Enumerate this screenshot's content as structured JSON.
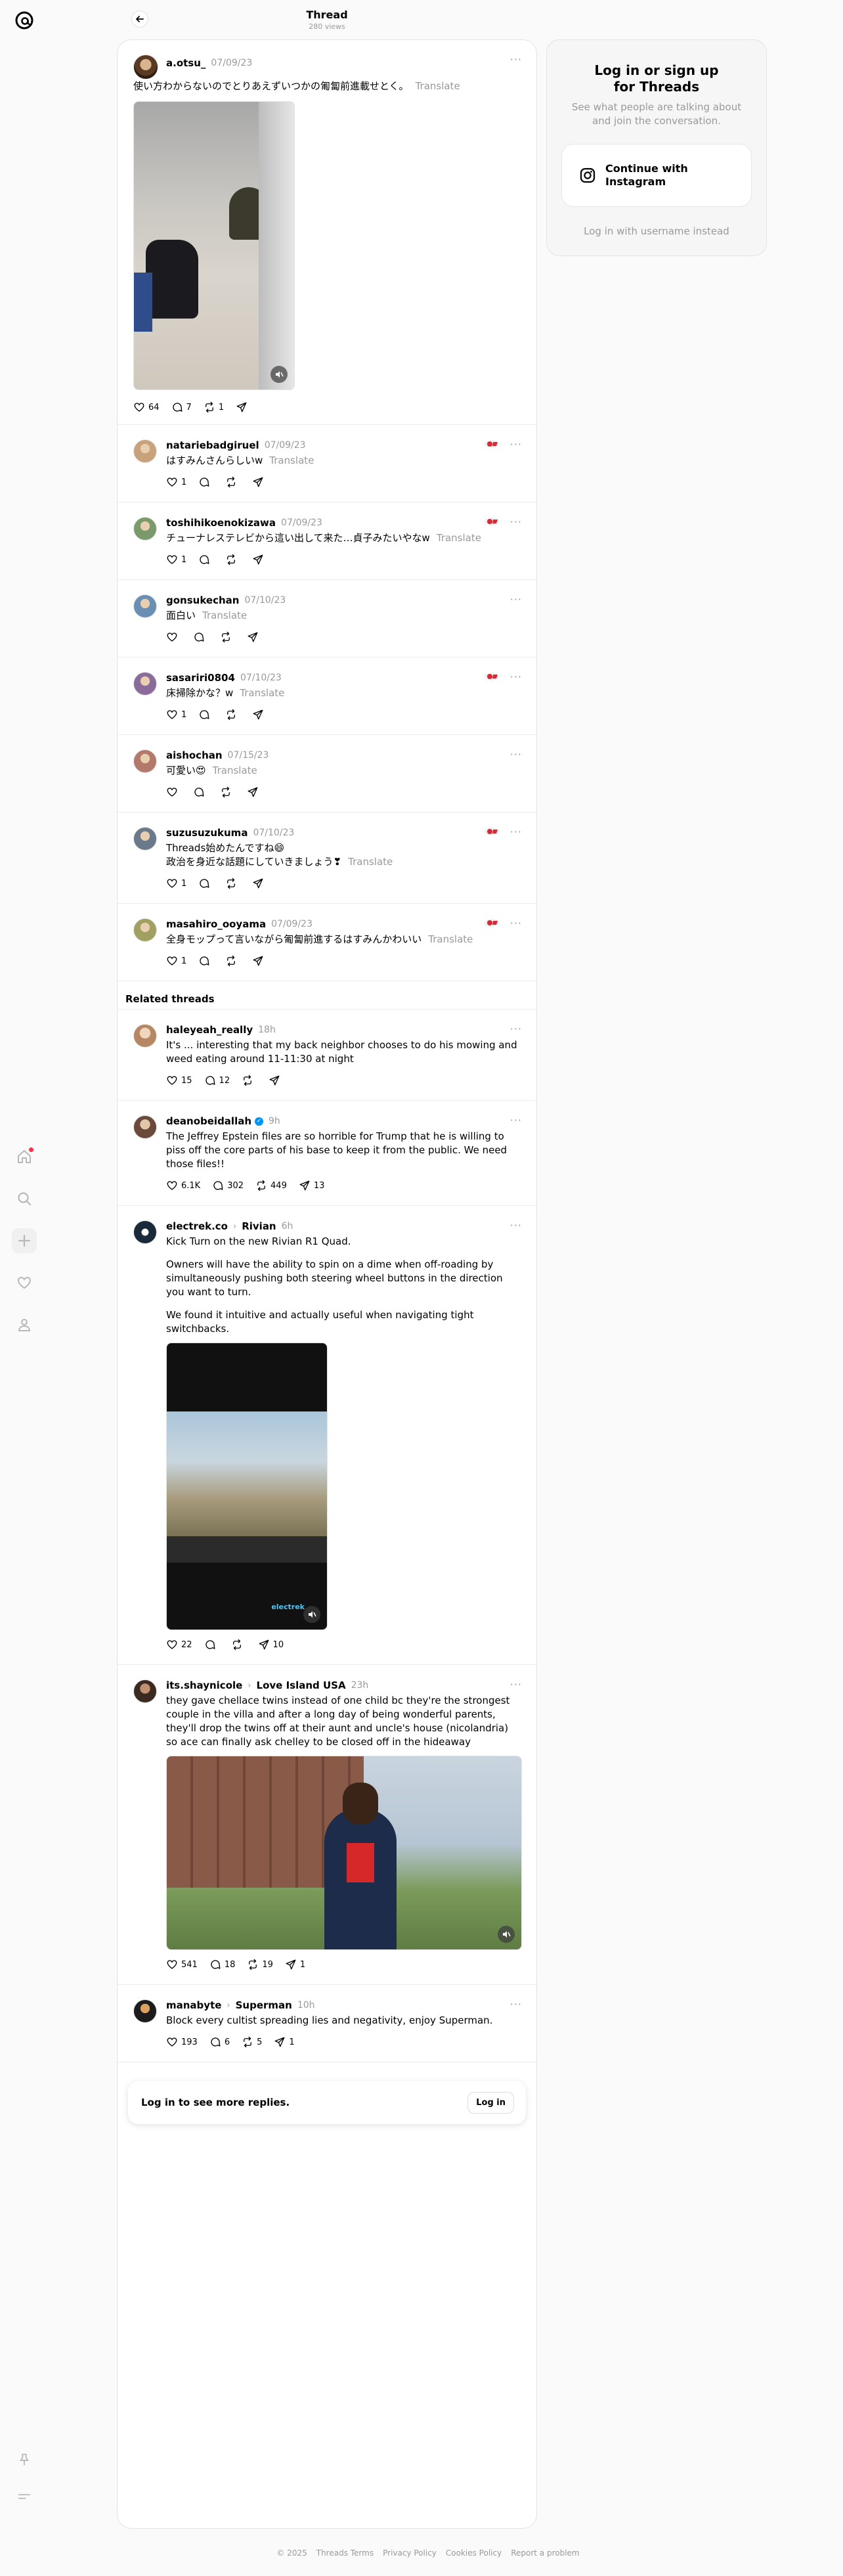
{
  "header": {
    "title": "Thread",
    "subtitle": "280 views"
  },
  "main_post": {
    "user": "a.otsu_",
    "time": "07/09/23",
    "text": "使い方わからないのでとりあえずいつかの匍匐前進載せとく。",
    "translate": "Translate",
    "likes": "64",
    "replies": "7",
    "reposts": "1"
  },
  "replies": [
    {
      "user": "natariebadgiruel",
      "time": "07/09/23",
      "text": "はすみんさんらしいw",
      "likes": "1",
      "badge": true
    },
    {
      "user": "toshihikoenokizawa",
      "time": "07/09/23",
      "text": "チューナレステレビから這い出して来た…貞子みたいやなw",
      "likes": "1",
      "badge": true
    },
    {
      "user": "gonsukechan",
      "time": "07/10/23",
      "text": "面白い",
      "likes": "",
      "badge": false
    },
    {
      "user": "sasariri0804",
      "time": "07/10/23",
      "text": "床掃除かな？w",
      "likes": "1",
      "badge": true
    },
    {
      "user": "aishochan",
      "time": "07/15/23",
      "text": "可愛い😍",
      "likes": "",
      "badge": false
    },
    {
      "user": "suzusuzukuma",
      "time": "07/10/23",
      "text": "Threads始めたんですね😄\n政治を身近な話題にしていきましょう❣",
      "likes": "1",
      "badge": true
    },
    {
      "user": "masahiro_ooyama",
      "time": "07/09/23",
      "text": "全身モップって言いながら匍匐前進するはすみんかわいい",
      "likes": "1",
      "badge": true
    }
  ],
  "related_label": "Related threads",
  "related": [
    {
      "user": "haleyeah_really",
      "time": "18h",
      "community": "",
      "verified": false,
      "paragraphs": [
        "It's ... interesting that my back neighbor chooses to do his mowing and weed eating around 11-11:30 at night"
      ],
      "likes": "15",
      "replies": "12",
      "reposts": "",
      "shares": ""
    },
    {
      "user": "deanobeidallah",
      "time": "9h",
      "community": "",
      "verified": true,
      "paragraphs": [
        "The Jeffrey Epstein files are so horrible for Trump that he is willing to piss off the core parts of his base to keep it from the public. We need those files!!"
      ],
      "likes": "6.1K",
      "replies": "302",
      "reposts": "449",
      "shares": "13"
    },
    {
      "user": "electrek.co",
      "time": "6h",
      "community": "Rivian",
      "verified": false,
      "paragraphs": [
        "Kick Turn on the new Rivian R1 Quad.",
        "Owners will have the ability to spin on a dime when off-roading by simultaneously pushing both steering wheel buttons in the direction you want to turn.",
        "We found it intuitive and actually useful when navigating tight switchbacks."
      ],
      "likes": "22",
      "replies": "",
      "reposts": "",
      "shares": "10"
    },
    {
      "user": "its.shaynicole",
      "time": "23h",
      "community": "Love Island USA",
      "verified": false,
      "paragraphs": [
        "they gave chellace twins instead of one child bc they're the strongest couple in the villa and after a long day of being wonderful parents, they'll drop the twins off at their aunt and uncle's house (nicolandria) so ace can finally ask chelley to be closed off in the hideaway"
      ],
      "likes": "541",
      "replies": "18",
      "reposts": "19",
      "shares": "1"
    },
    {
      "user": "manabyte",
      "time": "10h",
      "community": "Superman",
      "verified": false,
      "paragraphs": [
        "Block every cultist spreading lies and negativity, enjoy Superman."
      ],
      "likes": "193",
      "replies": "6",
      "reposts": "5",
      "shares": "1"
    }
  ],
  "electrek_watermark": "electrek",
  "login_prompt": {
    "text": "Log in to see more replies.",
    "button": "Log in"
  },
  "right_card": {
    "title": "Log in or sign up for Threads",
    "subtitle": "See what people are talking about and join the conversation.",
    "instagram_button": "Continue with Instagram",
    "username_link": "Log in with username instead"
  },
  "footer": [
    "© 2025",
    "Threads Terms",
    "Privacy Policy",
    "Cookies Policy",
    "Report a problem"
  ]
}
